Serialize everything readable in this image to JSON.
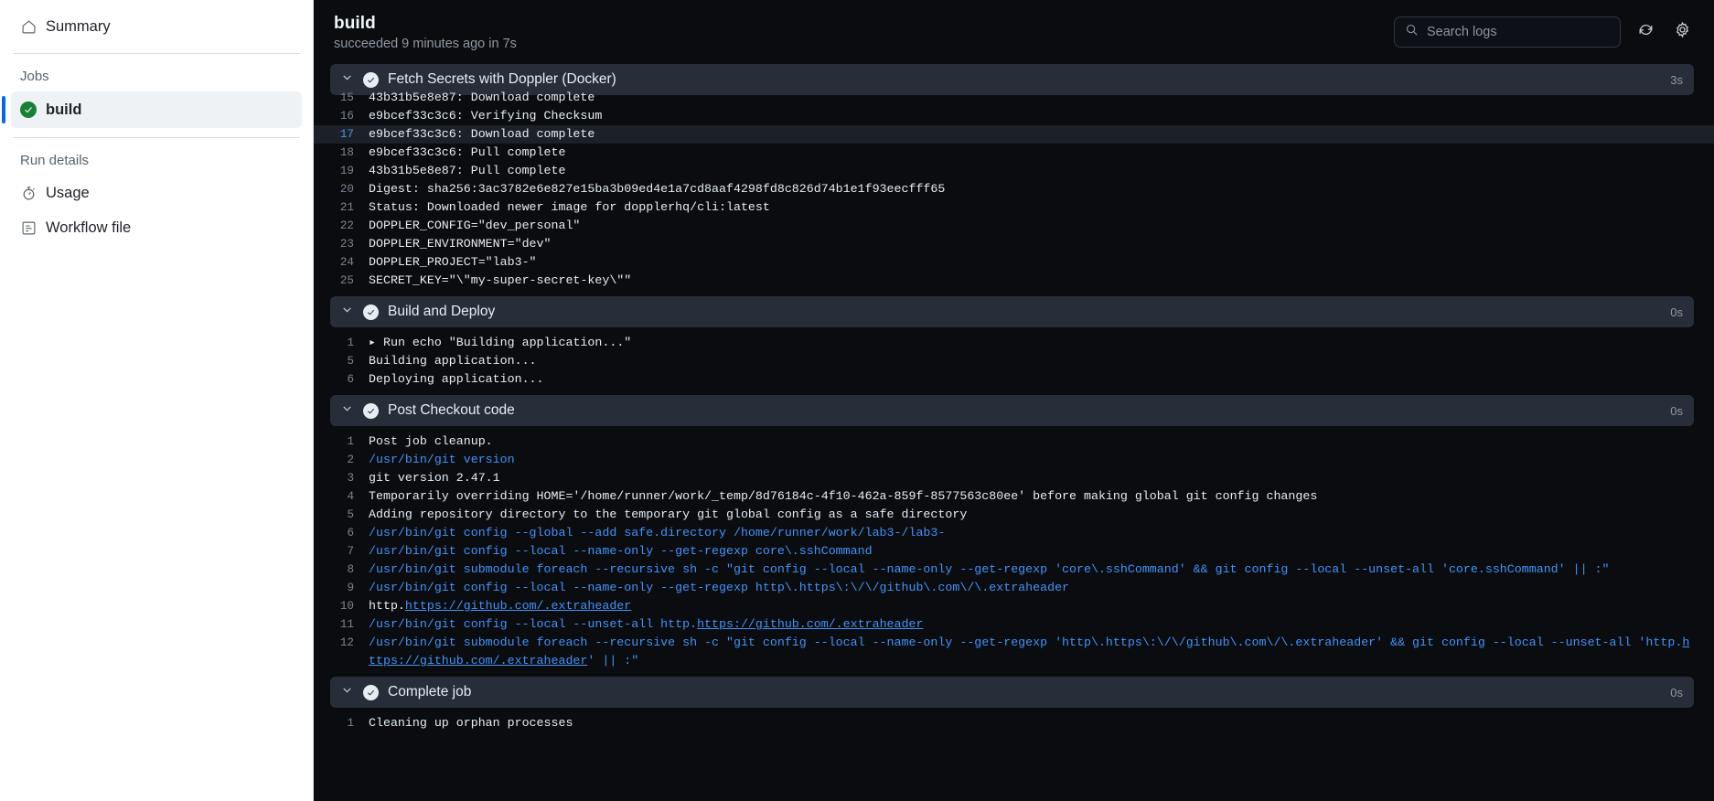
{
  "sidebar": {
    "summary": {
      "label": "Summary",
      "icon": "home-icon"
    },
    "jobs_heading": "Jobs",
    "jobs": [
      {
        "label": "build",
        "status": "success"
      }
    ],
    "run_details_heading": "Run details",
    "run_details": [
      {
        "label": "Usage",
        "icon": "stopwatch-icon"
      },
      {
        "label": "Workflow file",
        "icon": "workflow-file-icon"
      }
    ]
  },
  "header": {
    "title": "build",
    "subtitle": "succeeded 9 minutes ago in 7s",
    "search_placeholder": "Search logs",
    "search_value": "",
    "refresh_icon": "refresh-icon",
    "settings_icon": "gear-icon"
  },
  "colors": {
    "accent": "#4493f8",
    "success": "#1a7f37",
    "log_bg": "#0a0c10",
    "group_bg": "#272e3a",
    "highlight_row": "#1c2128"
  },
  "groups": [
    {
      "name": "Fetch Secrets with Doppler (Docker)",
      "duration": "3s",
      "status": "success",
      "expanded": true,
      "lines": [
        {
          "n": "15",
          "text": "43b31b5e8e87: Download complete",
          "style": "plain",
          "clipped": true
        },
        {
          "n": "16",
          "text": "e9bcef33c3c6: Verifying Checksum",
          "style": "plain"
        },
        {
          "n": "17",
          "text": "e9bcef33c3c6: Download complete",
          "style": "plain",
          "highlight": true
        },
        {
          "n": "18",
          "text": "e9bcef33c3c6: Pull complete",
          "style": "plain"
        },
        {
          "n": "19",
          "text": "43b31b5e8e87: Pull complete",
          "style": "plain"
        },
        {
          "n": "20",
          "text": "Digest: sha256:3ac3782e6e827e15ba3b09ed4e1a7cd8aaf4298fd8c826d74b1e1f93eecfff65",
          "style": "plain"
        },
        {
          "n": "21",
          "text": "Status: Downloaded newer image for dopplerhq/cli:latest",
          "style": "plain"
        },
        {
          "n": "22",
          "text": "DOPPLER_CONFIG=\"dev_personal\"",
          "style": "plain"
        },
        {
          "n": "23",
          "text": "DOPPLER_ENVIRONMENT=\"dev\"",
          "style": "plain"
        },
        {
          "n": "24",
          "text": "DOPPLER_PROJECT=\"lab3-\"",
          "style": "plain"
        },
        {
          "n": "25",
          "text": "SECRET_KEY=\"\\\"my-super-secret-key\\\"\"",
          "style": "plain"
        }
      ]
    },
    {
      "name": "Build and Deploy",
      "duration": "0s",
      "status": "success",
      "expanded": true,
      "lines": [
        {
          "n": "1",
          "text": "▸ Run echo \"Building application...\"",
          "style": "plain"
        },
        {
          "n": "5",
          "text": "Building application...",
          "style": "plain"
        },
        {
          "n": "6",
          "text": "Deploying application...",
          "style": "plain"
        }
      ]
    },
    {
      "name": "Post Checkout code",
      "duration": "0s",
      "status": "success",
      "expanded": true,
      "lines": [
        {
          "n": "1",
          "text": "Post job cleanup.",
          "style": "plain"
        },
        {
          "n": "2",
          "text": "/usr/bin/git version",
          "style": "cmd"
        },
        {
          "n": "3",
          "text": "git version 2.47.1",
          "style": "plain"
        },
        {
          "n": "4",
          "text": "Temporarily overriding HOME='/home/runner/work/_temp/8d76184c-4f10-462a-859f-8577563c80ee' before making global git config changes",
          "style": "plain"
        },
        {
          "n": "5",
          "text": "Adding repository directory to the temporary git global config as a safe directory",
          "style": "plain"
        },
        {
          "n": "6",
          "text": "/usr/bin/git config --global --add safe.directory /home/runner/work/lab3-/lab3-",
          "style": "cmd"
        },
        {
          "n": "7",
          "text": "/usr/bin/git config --local --name-only --get-regexp core\\.sshCommand",
          "style": "cmd"
        },
        {
          "n": "8",
          "text": "/usr/bin/git submodule foreach --recursive sh -c \"git config --local --name-only --get-regexp 'core\\.sshCommand' && git config --local --unset-all 'core.sshCommand' || :\"",
          "style": "cmd"
        },
        {
          "n": "9",
          "text": "/usr/bin/git config --local --name-only --get-regexp http\\.https\\:\\/\\/github\\.com\\/\\.extraheader",
          "style": "cmd"
        },
        {
          "n": "10",
          "style": "mixed",
          "parts": [
            {
              "t": "http.",
              "k": "plain"
            },
            {
              "t": "https://github.com/.extraheader",
              "k": "link"
            }
          ]
        },
        {
          "n": "11",
          "style": "mixed",
          "parts": [
            {
              "t": "/usr/bin/git config --local --unset-all http.",
              "k": "cmd"
            },
            {
              "t": "https://github.com/.extraheader",
              "k": "link"
            }
          ]
        },
        {
          "n": "12",
          "style": "mixed",
          "parts": [
            {
              "t": "/usr/bin/git submodule foreach --recursive sh -c \"git config --local --name-only --get-regexp 'http\\.https\\:\\/\\/github\\.com\\/\\.extraheader' && git config --local --unset-all 'http.",
              "k": "cmd"
            },
            {
              "t": "https://github.com/.extraheader",
              "k": "link"
            },
            {
              "t": "' || :\"",
              "k": "cmd"
            }
          ]
        }
      ]
    },
    {
      "name": "Complete job",
      "duration": "0s",
      "status": "success",
      "expanded": true,
      "lines": [
        {
          "n": "1",
          "text": "Cleaning up orphan processes",
          "style": "plain"
        }
      ]
    }
  ]
}
